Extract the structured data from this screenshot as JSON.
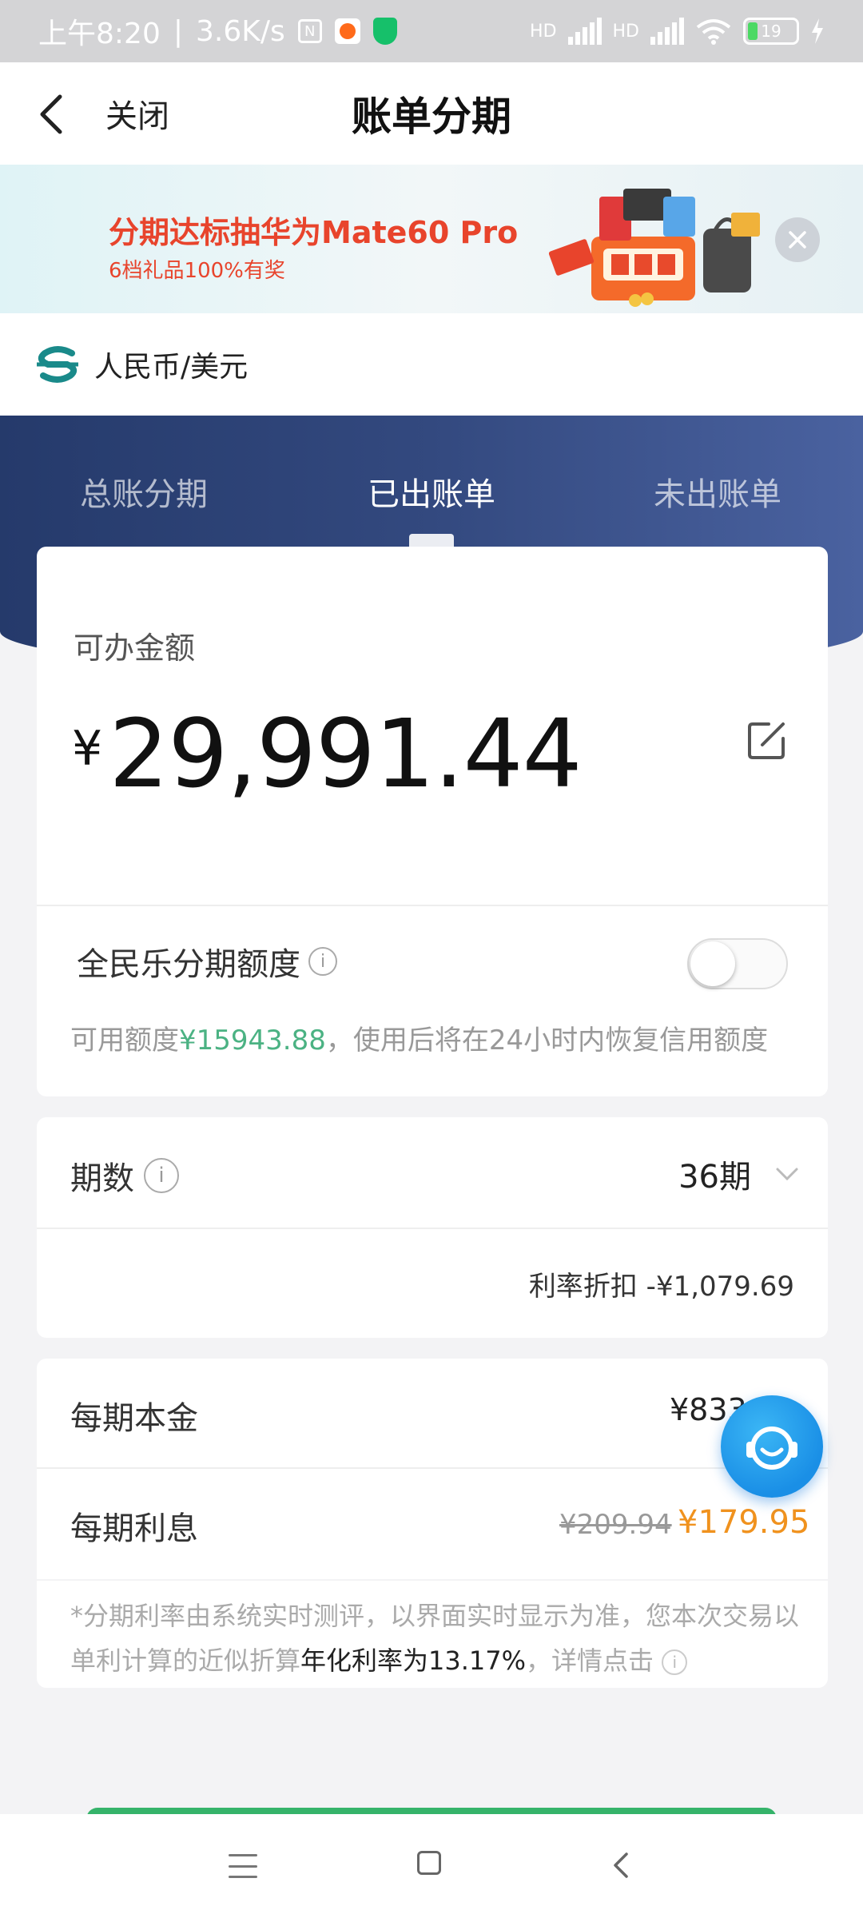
{
  "status_bar": {
    "time": "上午8:20",
    "speed": "3.6K/s",
    "battery": "19",
    "hd1": "HD",
    "hd2": "HD"
  },
  "nav": {
    "close_label": "关闭",
    "title": "账单分期"
  },
  "banner": {
    "title": "分期达标抽华为Mate60 Pro",
    "subtitle": "6档礼品100%有奖"
  },
  "currency": {
    "label": "人民币/美元"
  },
  "tabs": [
    "总账分期",
    "已出账单",
    "未出账单"
  ],
  "active_tab": 1,
  "amount": {
    "label": "可办金额",
    "currency_symbol": "¥",
    "value": "29,991.44"
  },
  "quota": {
    "label": "全民乐分期额度",
    "toggle_on": false,
    "note_prefix": "可用额度",
    "note_amount": "¥15943.88",
    "note_suffix": "，使用后将在24小时内恢复信用额度"
  },
  "term": {
    "label": "期数",
    "value": "36期",
    "discount": "利率折扣 -¥1,079.69"
  },
  "per_period": {
    "principal_label": "每期本金",
    "principal_value": "¥833",
    "interest_label": "每期利息",
    "interest_old": "¥209.94",
    "interest_new": "¥179.95"
  },
  "footnote": {
    "part1": "*分期利率由系统实时测评，以界面实时显示为准，您本次交易以单利计算的近似折算",
    "highlight": "年化利率为13.17%",
    "part2": "，详情点击"
  },
  "colors": {
    "header_blue": "#33497f",
    "green_accent": "#4bb283",
    "orange_price": "#f0921e",
    "banner_red": "#e8442c",
    "button_green": "#35b36a"
  },
  "icons": {
    "back": "chevron-left-icon",
    "close_banner": "close-icon",
    "edit": "edit-icon",
    "info": "info-icon",
    "chevron": "chevron-down-icon",
    "customer_service": "headset-icon",
    "bank_logo": "bank-logo-icon"
  }
}
